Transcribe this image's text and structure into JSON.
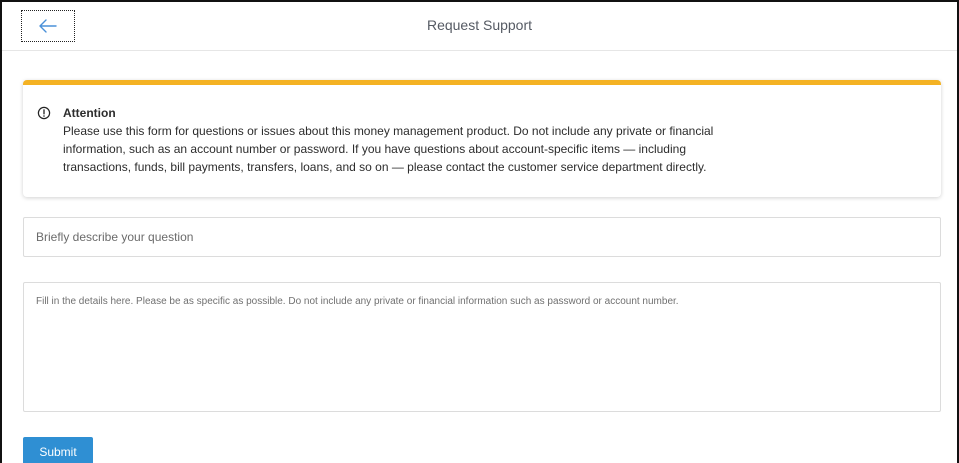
{
  "header": {
    "title": "Request Support",
    "back_icon": "arrow-left-icon"
  },
  "notice": {
    "icon": "alert-circle-icon",
    "accent_color": "#f4b223",
    "title": "Attention",
    "body": "Please use this form for questions or issues about this money management product. Do not include any private or financial information, such as an account number or password. If you have questions about account-specific items — including transactions, funds, bill payments, transfers, loans, and so on — please contact the customer service department directly."
  },
  "form": {
    "subject_placeholder": "Briefly describe your question",
    "subject_value": "",
    "details_placeholder": "Fill in the details here. Please be as specific as possible. Do not include any private or financial information such as password or account number.",
    "details_value": "",
    "submit_label": "Submit",
    "submit_color": "#2f8fd3"
  }
}
